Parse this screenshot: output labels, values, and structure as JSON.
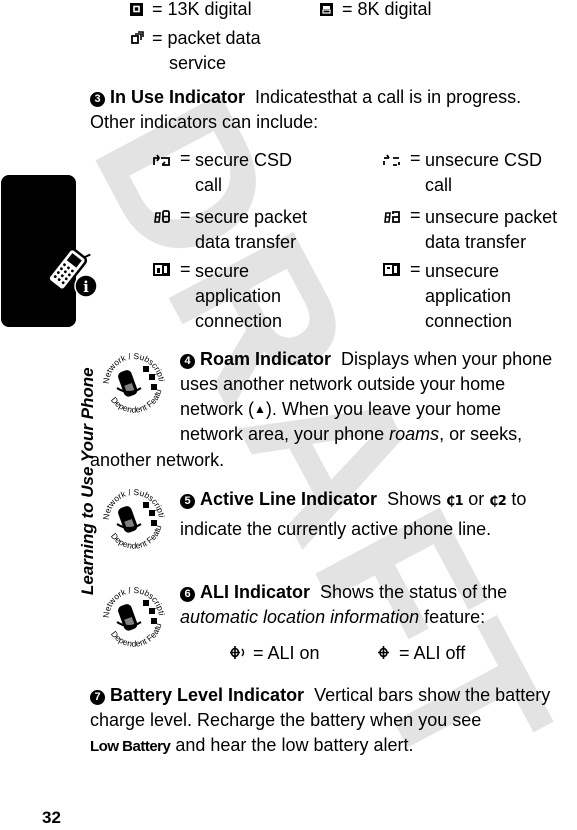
{
  "watermark": "DRAFT",
  "sidebar": {
    "section_title": "Learning to Use Your Phone",
    "tab_icon": "phone-info-icon"
  },
  "page_number": "32",
  "top_legend": [
    {
      "icon": "13k-digital-icon",
      "label": "= 13K digital"
    },
    {
      "icon": "8k-digital-icon",
      "label": "= 8K digital"
    },
    {
      "icon": "packet-data-icon",
      "label_line1": "= packet data",
      "label_line2": "service"
    }
  ],
  "sections": {
    "in_use": {
      "number": "3",
      "title": "In Use Indicator",
      "body_line1": "Indicatesthat a call is in progress.",
      "body_line2": "Other indicators can include:",
      "indicators": [
        {
          "icon": "secure-csd-call-icon",
          "line1": "secure CSD",
          "line2": "call"
        },
        {
          "icon": "unsecure-csd-call-icon",
          "line1": "unsecure CSD",
          "line2": "call"
        },
        {
          "icon": "secure-packet-data-icon",
          "line1": "secure packet",
          "line2": "data transfer"
        },
        {
          "icon": "unsecure-packet-data-icon",
          "line1": "unsecure packet",
          "line2": "data transfer"
        },
        {
          "icon": "secure-app-connection-icon",
          "line1": "secure",
          "line2": "application",
          "line3": "connection"
        },
        {
          "icon": "unsecure-app-connection-icon",
          "line1": "unsecure",
          "line2": "application",
          "line3": "connection"
        }
      ]
    },
    "roam": {
      "number": "4",
      "title": "Roam Indicator",
      "line1": "Displays when your phone",
      "line2": "uses another network outside your home",
      "line3a": "network (",
      "line3_icon": "▲",
      "line3b": "). When you leave your home",
      "line4a": "network area, your phone ",
      "line4_italic": "roams",
      "line4b": ", or seeks,",
      "line5": "another network."
    },
    "active_line": {
      "number": "5",
      "title": "Active Line Indicator",
      "text_a": "Shows",
      "icon1": "₵1",
      "text_or": "or",
      "icon2": "₵2",
      "text_b": "to",
      "line2": "indicate the currently active phone line."
    },
    "ali": {
      "number": "6",
      "title": "ALI Indicator",
      "line1": "Shows the status of the",
      "line2_italic": "automatic location information",
      "line2b": " feature:",
      "on_label": "= ALI on",
      "off_label": "= ALI off"
    },
    "battery": {
      "number": "7",
      "title": "Battery Level Indicator",
      "line1": "Vertical bars show the battery",
      "line2": "charge level. Recharge the battery when you see",
      "display_text": "Low Battery",
      "line3b": " and hear the low battery alert."
    }
  },
  "badge": {
    "top_text": "Network / Subscription",
    "bottom_text": "Dependent Feature"
  }
}
